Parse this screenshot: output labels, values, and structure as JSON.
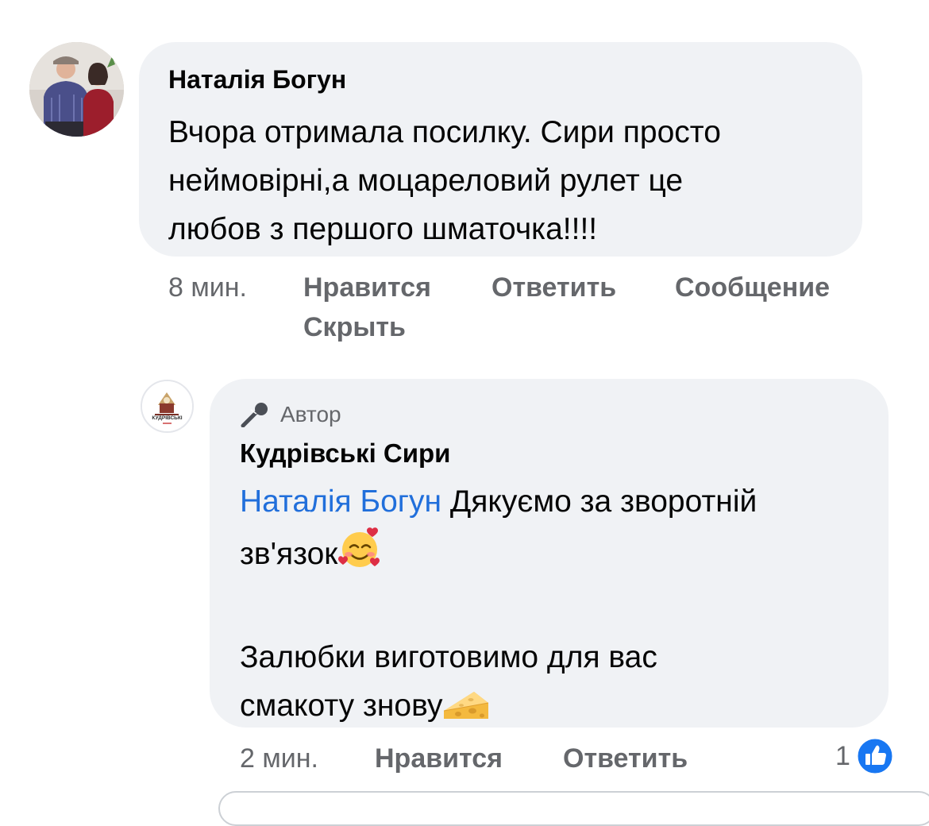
{
  "comment": {
    "author": "Наталія Богун",
    "text_lines": [
      "Вчора отримала посилку. Сири просто",
      "неймовірні,а моцареловий рулет це",
      "любов з першого шматочка!!!!"
    ],
    "time": "8 мин.",
    "actions": {
      "like": "Нравится",
      "reply": "Ответить",
      "message": "Сообщение",
      "hide": "Скрыть"
    }
  },
  "reply": {
    "badge_icon": "microphone-icon",
    "badge": "Автор",
    "author": "Кудрівські Сири",
    "avatar_logo_text": "КУДРІВСЬКІ",
    "mention": "Наталія Богун",
    "text_line1_rest": "Дякуємо за зворотній",
    "text_line2": "зв'язок",
    "text_line2_emoji": "smiling-face-with-hearts-icon",
    "text_line4": "Залюбки виготовимо для вас",
    "text_line5": "смакоту знову",
    "text_line5_emoji": "cheese-wedge-icon",
    "time": "2 мин.",
    "actions": {
      "like": "Нравится",
      "reply": "Ответить"
    },
    "reaction_count": "1",
    "reaction_icon": "like-thumb-icon"
  },
  "colors": {
    "bubble": "#f0f2f5",
    "meta_text": "#65676b",
    "mention": "#216fdb",
    "like_blue": "#1877f2"
  }
}
